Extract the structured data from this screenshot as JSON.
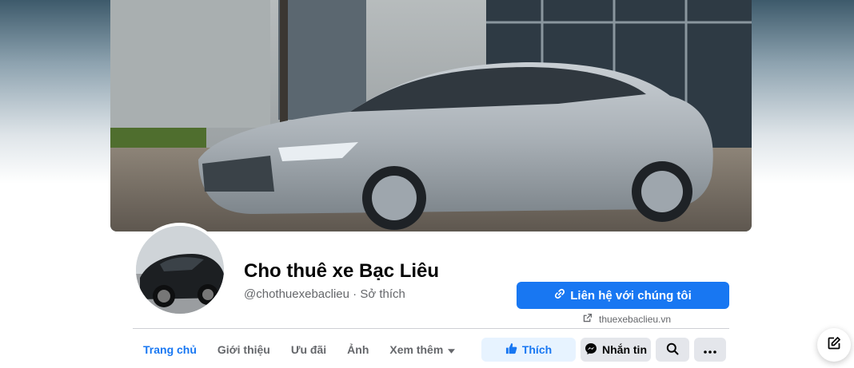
{
  "page": {
    "title": "Cho thuê xe Bạc Liêu",
    "subtitle": "@chothuexebaclieu · Sở thích"
  },
  "contact": {
    "label": "Liên hệ với chúng tôi",
    "website": "thuexebaclieu.vn"
  },
  "nav": [
    {
      "label": "Trang chủ",
      "active": true
    },
    {
      "label": "Giới thiệu"
    },
    {
      "label": "Ưu đãi"
    },
    {
      "label": "Ảnh"
    },
    {
      "label": "Xem thêm"
    }
  ],
  "actions": {
    "like": "Thích",
    "message": "Nhắn tin"
  },
  "colors": {
    "accent": "#1877f2",
    "secondary_bg": "#e4e6eb",
    "like_bg": "#e7f3ff",
    "muted_text": "#65676b"
  },
  "icons": [
    "link-icon",
    "external-link-icon",
    "like-icon",
    "messenger-icon",
    "search-icon",
    "more-icon",
    "caret-down-icon",
    "compose-icon"
  ]
}
